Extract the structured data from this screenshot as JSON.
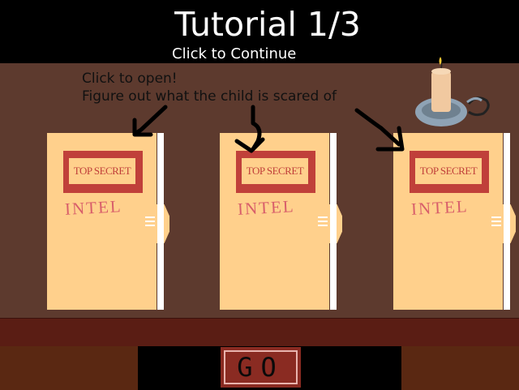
{
  "header": {
    "title": "Tutorial 1/3",
    "subtitle": "Click to Continue"
  },
  "hint": {
    "line1": "Click to open!",
    "line2": "Figure out what the child is scared of"
  },
  "folders": [
    {
      "stamp": "TOP SECRET",
      "label": "INTEL"
    },
    {
      "stamp": "TOP SECRET",
      "label": "INTEL"
    },
    {
      "stamp": "TOP SECRET",
      "label": "INTEL"
    }
  ],
  "go_button": {
    "label": "GO"
  },
  "colors": {
    "wall": "#5d3a2e",
    "folder": "#ffd08c",
    "stamp": "#c0403a",
    "intel_text": "#d85e6a",
    "shelf": "#5a1d14",
    "go_button": "#8a2b22"
  },
  "icons": {
    "candle": "candle-icon",
    "arrow": "hand-drawn-arrow-icon"
  }
}
